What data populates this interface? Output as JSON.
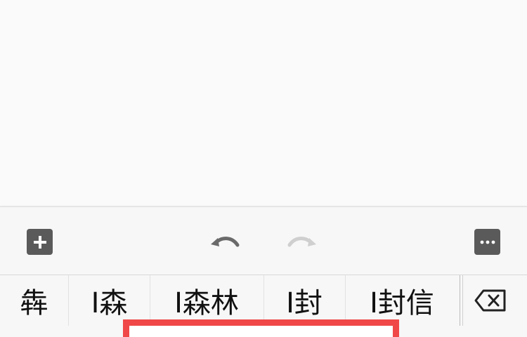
{
  "toolbar": {
    "add_icon": "plus-icon",
    "undo_icon": "undo-icon",
    "redo_icon": "redo-icon",
    "more_icon": "more-dots-icon",
    "redo_enabled": false
  },
  "candidates": [
    {
      "text": "犇"
    },
    {
      "text": "I森"
    },
    {
      "text": "I森林"
    },
    {
      "text": "I封"
    },
    {
      "text": "I封信"
    }
  ],
  "keyboard": {
    "delete_icon": "backspace-icon"
  },
  "colors": {
    "toolbar_button_bg": "#5a5a5a",
    "undo_icon": "#6a6a6a",
    "redo_icon_disabled": "#cfcfcf",
    "highlight_border": "#f04848"
  }
}
